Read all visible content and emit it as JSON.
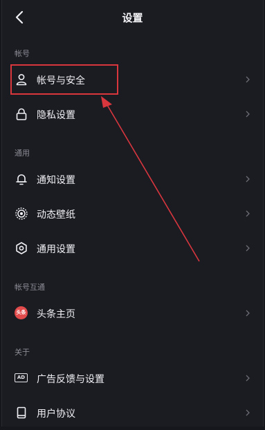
{
  "header": {
    "title": "设置"
  },
  "sections": {
    "account": "帐号",
    "general": "通用",
    "linked": "帐号互通",
    "about": "关于"
  },
  "items": {
    "account_security": "帐号与安全",
    "privacy": "隐私设置",
    "notifications": "通知设置",
    "wallpaper": "动态壁纸",
    "general_settings": "通用设置",
    "toutiao_home": "头条主页",
    "ad_feedback": "广告反馈与设置",
    "user_agreement": "用户协议"
  },
  "badges": {
    "toutiao": "头条",
    "ad": "AD"
  },
  "colors": {
    "background": "#1b1c22",
    "annotation": "#d9363e",
    "section_label": "#8b8c94"
  }
}
